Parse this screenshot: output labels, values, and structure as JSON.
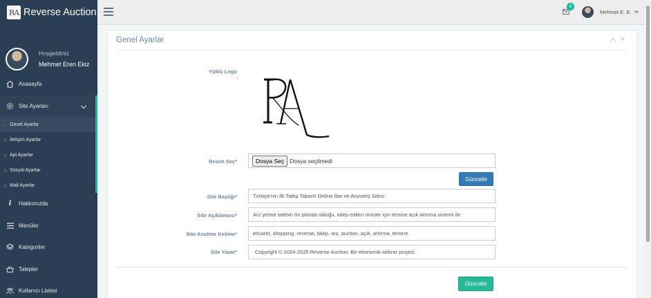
{
  "brand": {
    "logo_text": "RA",
    "name": "Reverse Auction"
  },
  "profile": {
    "welcome": "Hoşgeldiniz",
    "name": "Mehmet Eren Ekiz"
  },
  "sidebar": {
    "items": [
      {
        "label": "Anasayfa",
        "icon": "home-icon"
      },
      {
        "label": "Site Ayarları",
        "icon": "gear-icon"
      },
      {
        "label": "Hakkımızda",
        "icon": "info-icon"
      },
      {
        "label": "Menüler",
        "icon": "bars-icon"
      },
      {
        "label": "Kategoriler",
        "icon": "layers-icon"
      },
      {
        "label": "Talepler",
        "icon": "basket-icon"
      },
      {
        "label": "Kullanıcı Listesi",
        "icon": "users-icon"
      }
    ],
    "submenu": [
      {
        "label": "Genel Ayarlar"
      },
      {
        "label": "İletişim Ayarlar"
      },
      {
        "label": "Api Ayarlar"
      },
      {
        "label": "Sosyal Ayarlar"
      },
      {
        "label": "Mail Ayarlar"
      }
    ]
  },
  "topnav": {
    "mail_badge": "6",
    "user": "Mehmet E. E."
  },
  "panel": {
    "title": "Genel Ayarlar",
    "logo_label": "Yüklü Logo",
    "logo_dash": "-",
    "file_label": "Resim Seç*",
    "file_button": "Dosya Seç",
    "file_status": "Dosya seçilmedi",
    "update_button": "Güncelle",
    "fields": {
      "title_label": "Site Başlığı*",
      "title_value": "Türkiye'nin İlk Talep Tabanlı Online İlan ve Alışveriş Sitesi",
      "desc_label": "Site Açıklaması*",
      "desc_value": "Arz yerine talebin ön planda olduğu, talep edilen ürünler için tersine açık artırma sistemi ile",
      "keywords_label": "Site Anahtar Kelime*",
      "keywords_value": "eticaret, shopping, reverse, talep, arz, auction, açık, artırma, tersine",
      "author_label": "Site Yazar*",
      "author_value": "Copyright © 2024-2025  Reverse Auction. Bir ekonomik istikrar projesi."
    },
    "submit_button": "Güncelle"
  },
  "colors": {
    "sidebar": "#2a3f54",
    "accent": "#1abb9c",
    "primary": "#337ab7",
    "success": "#26b99a"
  }
}
